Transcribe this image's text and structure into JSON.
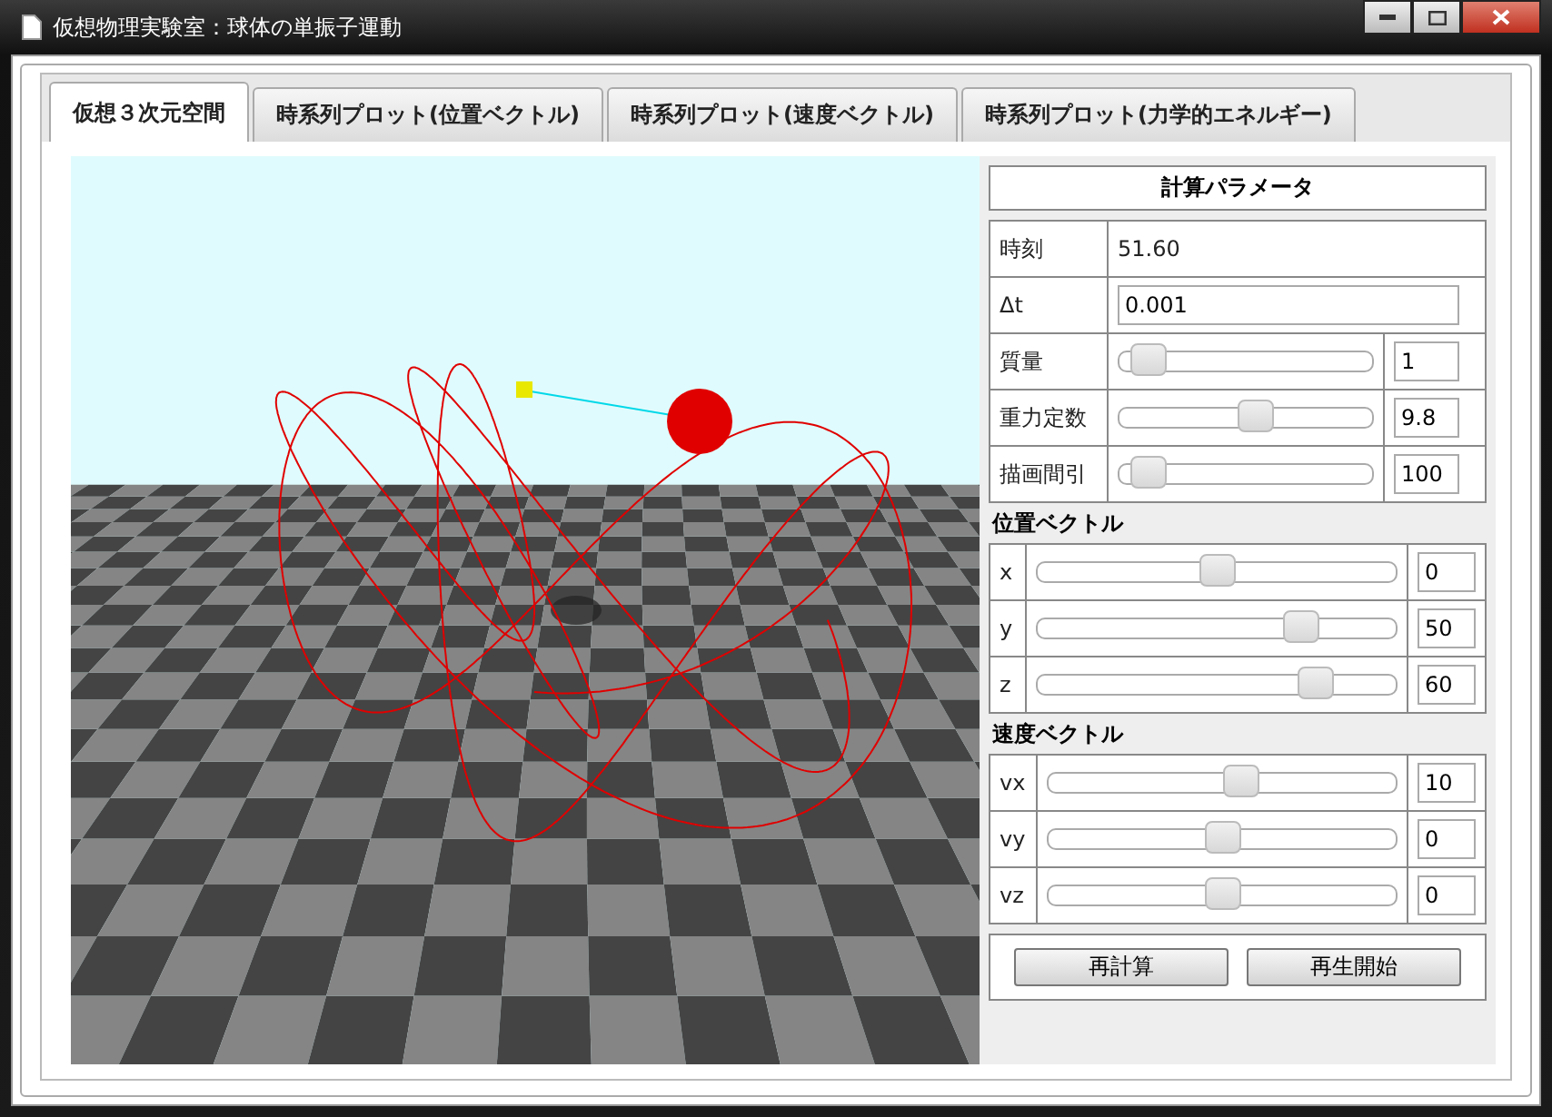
{
  "window": {
    "title": "仮想物理実験室：球体の単振子運動"
  },
  "tabs": [
    {
      "label": "仮想３次元空間",
      "selected": true
    },
    {
      "label": "時系列プロット(位置ベクトル)",
      "selected": false
    },
    {
      "label": "時系列プロット(速度ベクトル)",
      "selected": false
    },
    {
      "label": "時系列プロット(力学的エネルギー)",
      "selected": false
    }
  ],
  "panel": {
    "title": "計算パラメータ",
    "params": [
      {
        "kind": "readout",
        "label": "時刻",
        "value": "51.60"
      },
      {
        "kind": "input",
        "label": "Δt",
        "value": "0.001"
      },
      {
        "kind": "slider",
        "label": "質量",
        "level": 0.05,
        "value": "1"
      },
      {
        "kind": "slider",
        "label": "重力定数",
        "level": 0.55,
        "value": "9.8"
      },
      {
        "kind": "slider",
        "label": "描画間引",
        "level": 0.05,
        "value": "100"
      }
    ],
    "groups": [
      {
        "title": "位置ベクトル",
        "rows": [
          {
            "label": "x",
            "level": 0.5,
            "value": "0"
          },
          {
            "label": "y",
            "level": 0.76,
            "value": "50"
          },
          {
            "label": "z",
            "level": 0.81,
            "value": "60"
          }
        ]
      },
      {
        "title": "速度ベクトル",
        "rows": [
          {
            "label": "vx",
            "level": 0.56,
            "value": "10"
          },
          {
            "label": "vy",
            "level": 0.5,
            "value": "0"
          },
          {
            "label": "vz",
            "level": 0.5,
            "value": "0"
          }
        ]
      }
    ],
    "buttons": [
      "再計算",
      "再生開始"
    ]
  }
}
